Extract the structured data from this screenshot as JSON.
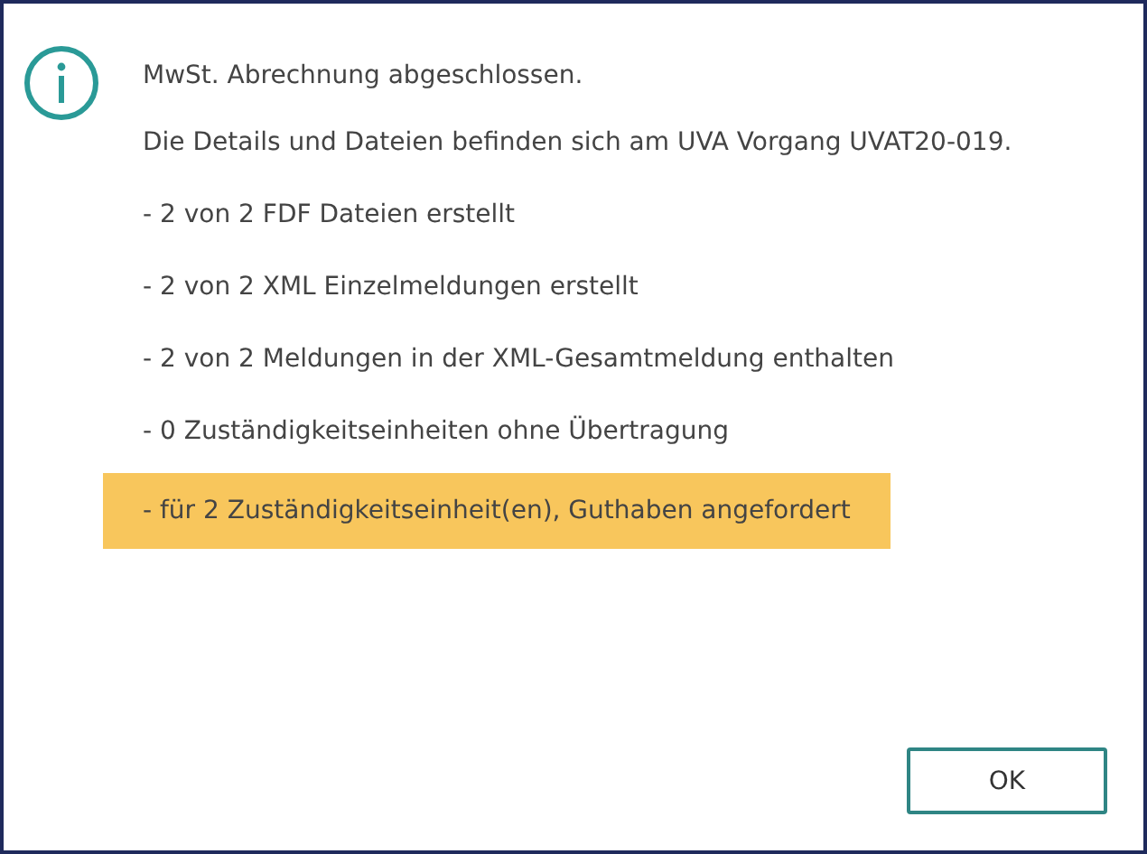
{
  "dialog": {
    "kind": "info",
    "title": "MwSt. Abrechnung abgeschlossen.",
    "paragraphs": [
      {
        "text": "Die Details und Dateien befinden sich am UVA Vorgang UVAT20-019.",
        "highlighted": false
      },
      {
        "text": "- 2 von 2 FDF Dateien erstellt",
        "highlighted": false
      },
      {
        "text": "- 2 von 2 XML Einzelmeldungen erstellt",
        "highlighted": false
      },
      {
        "text": "- 2 von 2 Meldungen in der XML-Gesamtmeldung enthalten",
        "highlighted": false
      },
      {
        "text": "- 0 Zuständigkeitseinheiten ohne Übertragung",
        "highlighted": false
      },
      {
        "text": "- für 2 Zuständigkeitseinheit(en), Guthaben angefordert",
        "highlighted": true
      }
    ],
    "buttons": [
      "OK"
    ]
  }
}
